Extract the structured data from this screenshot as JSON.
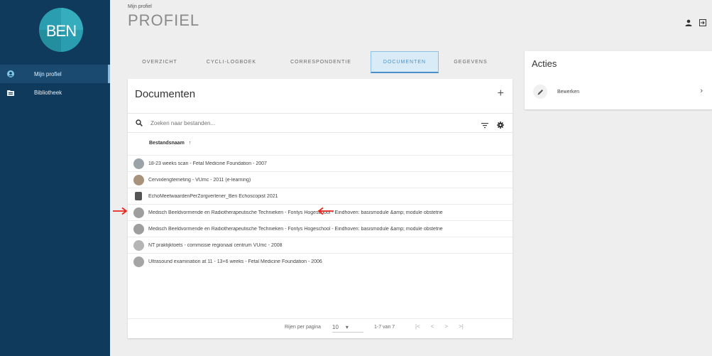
{
  "logo_text": "BEN",
  "sidebar": {
    "items": [
      {
        "label": "Mijn profiel",
        "icon": "account-circle-icon",
        "active": true
      },
      {
        "label": "Bibliotheek",
        "icon": "folder-icon",
        "active": false
      }
    ]
  },
  "header": {
    "breadcrumb": "Mijn profiel",
    "title": "PROFIEL"
  },
  "tabs": [
    {
      "label": "OVERZICHT",
      "active": false
    },
    {
      "label": "CYCLI-LOGBOEK",
      "active": false
    },
    {
      "label": "CORRESPONDENTIE",
      "active": false
    },
    {
      "label": "DOCUMENTEN",
      "active": true
    },
    {
      "label": "GEGEVENS",
      "active": false
    }
  ],
  "documents": {
    "title": "Documenten",
    "add_symbol": "+",
    "search_placeholder": "Zoeken naar bestanden...",
    "column_header": "Bestandsnaam",
    "sort_indicator": "↑",
    "rows": [
      {
        "name": "18-23 weeks scan - Fetal Medicine Foundation - 2007",
        "thumb_color": "#9aa3a8"
      },
      {
        "name": "Cervixlengtemeting - VUmc - 2011 (e-learning)",
        "thumb_color": "#a8927c"
      },
      {
        "name": "EchoMeetwaardenPerZorgverlener_Ben Echoscopist 2021",
        "thumb_color": "#555555"
      },
      {
        "name": "Medisch Beeldvormende en Radiotherapeutische Technieken - Fontys Hogeschool - Eindhoven: basismodule &amp; module obstetrie",
        "thumb_color": "#9e9e9e"
      },
      {
        "name": "Medisch Beeldvormende en Radiotherapeutische Technieken - Fontys Hogeschool - Eindhoven: basismodule &amp; module obstetrie",
        "thumb_color": "#9e9e9e"
      },
      {
        "name": "NT praktijktoets - commissie regionaal centrum VUmc - 2008",
        "thumb_color": "#b5b5b5"
      },
      {
        "name": "Ultrasound examination at 11 - 13+6 weeks - Fetal Medicine Foundation - 2006",
        "thumb_color": "#a5a5a5"
      }
    ],
    "pagination": {
      "rows_per_page_label": "Rijen per pagina",
      "rows_per_page": "10",
      "range": "1-7 van 7"
    }
  },
  "acties": {
    "title": "Acties",
    "items": [
      {
        "label": "Bewerken",
        "icon": "pencil-icon"
      }
    ]
  },
  "colors": {
    "sidebar_bg": "#0f3a5c",
    "active_tab_bg": "#d9ebf7",
    "accent": "#4a90c8",
    "annotation_red": "#e8281e"
  }
}
